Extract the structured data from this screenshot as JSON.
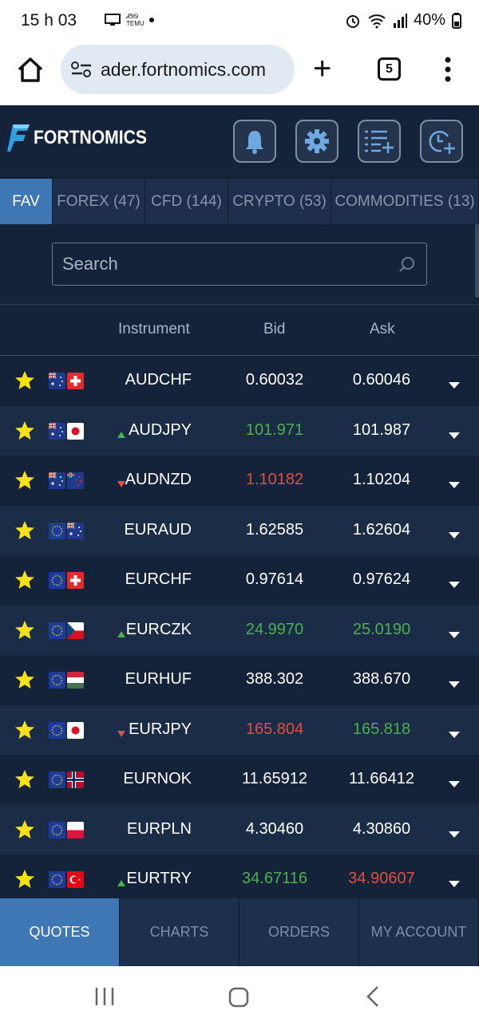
{
  "status": {
    "time": "15 h 03",
    "battery": "40%",
    "mini_label": "ᏗᏕᏫ TEMU"
  },
  "browser": {
    "url": "ader.fortnomics.com",
    "tab_count": "5"
  },
  "app": {
    "logo_text": "FORTNOMICS",
    "tabs": [
      "FAV",
      "FOREX (47)",
      "CFD (144)",
      "CRYPTO (53)",
      "COMMODITIES (13)"
    ],
    "active_tab": "FAV",
    "search_placeholder": "Search",
    "columns": {
      "instrument": "Instrument",
      "bid": "Bid",
      "ask": "Ask"
    },
    "rows": [
      {
        "symbol": "AUDCHF",
        "bid": "0.60032",
        "ask": "0.60046",
        "trend": "",
        "bid_color": "white",
        "ask_color": "white",
        "flags": [
          "au",
          "ch"
        ]
      },
      {
        "symbol": "AUDJPY",
        "bid": "101.971",
        "ask": "101.987",
        "trend": "up",
        "bid_color": "green",
        "ask_color": "white",
        "flags": [
          "au",
          "jp"
        ]
      },
      {
        "symbol": "AUDNZD",
        "bid": "1.10182",
        "ask": "1.10204",
        "trend": "down",
        "bid_color": "red",
        "ask_color": "white",
        "flags": [
          "au",
          "nz"
        ]
      },
      {
        "symbol": "EURAUD",
        "bid": "1.62585",
        "ask": "1.62604",
        "trend": "",
        "bid_color": "white",
        "ask_color": "white",
        "flags": [
          "eu",
          "au"
        ]
      },
      {
        "symbol": "EURCHF",
        "bid": "0.97614",
        "ask": "0.97624",
        "trend": "",
        "bid_color": "white",
        "ask_color": "white",
        "flags": [
          "eu",
          "ch"
        ]
      },
      {
        "symbol": "EURCZK",
        "bid": "24.9970",
        "ask": "25.0190",
        "trend": "up",
        "bid_color": "green",
        "ask_color": "green",
        "flags": [
          "eu",
          "cz"
        ]
      },
      {
        "symbol": "EURHUF",
        "bid": "388.302",
        "ask": "388.670",
        "trend": "",
        "bid_color": "white",
        "ask_color": "white",
        "flags": [
          "eu",
          "hu"
        ]
      },
      {
        "symbol": "EURJPY",
        "bid": "165.804",
        "ask": "165.818",
        "trend": "down",
        "bid_color": "red",
        "ask_color": "green",
        "flags": [
          "eu",
          "jp"
        ]
      },
      {
        "symbol": "EURNOK",
        "bid": "11.65912",
        "ask": "11.66412",
        "trend": "",
        "bid_color": "white",
        "ask_color": "white",
        "flags": [
          "eu",
          "no"
        ]
      },
      {
        "symbol": "EURPLN",
        "bid": "4.30460",
        "ask": "4.30860",
        "trend": "",
        "bid_color": "white",
        "ask_color": "white",
        "flags": [
          "eu",
          "pl"
        ]
      },
      {
        "symbol": "EURTRY",
        "bid": "34.67116",
        "ask": "34.90607",
        "trend": "up",
        "bid_color": "green",
        "ask_color": "red",
        "flags": [
          "eu",
          "tr"
        ]
      }
    ],
    "bottom_nav": [
      "QUOTES",
      "CHARTS",
      "ORDERS",
      "MY ACCOUNT"
    ],
    "colors": {
      "background": "#14233a",
      "accent": "#3f77b4",
      "up": "#4caf50",
      "down": "#e0503f",
      "star": "#f5e11a"
    }
  }
}
